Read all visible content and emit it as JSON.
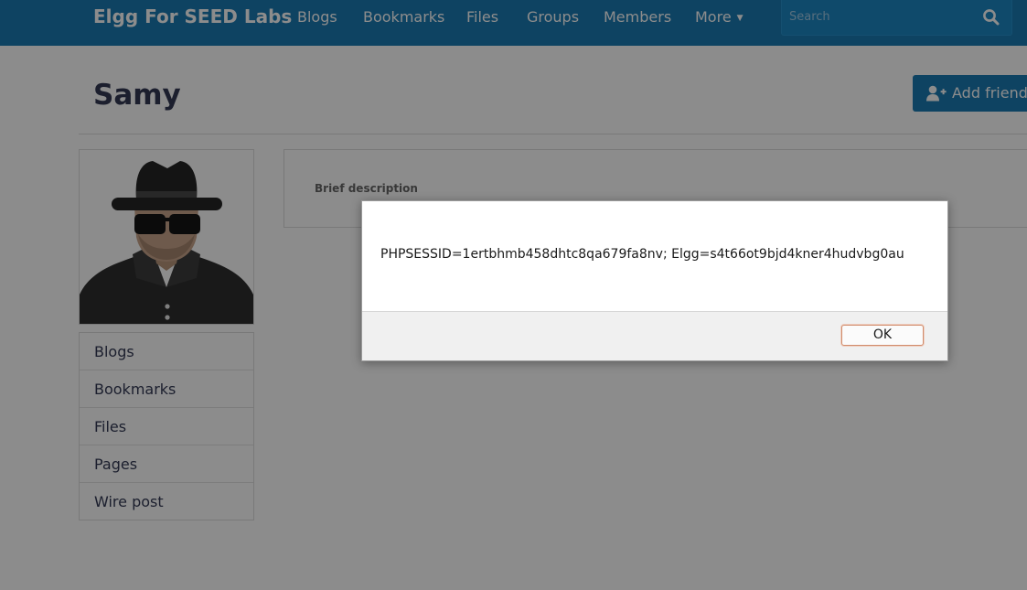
{
  "topbar": {
    "brand": "Elgg For SEED Labs",
    "nav": [
      {
        "label": "Blogs"
      },
      {
        "label": "Bookmarks"
      },
      {
        "label": "Files"
      },
      {
        "label": "Groups"
      },
      {
        "label": "Members"
      },
      {
        "label": "More"
      }
    ],
    "search": {
      "placeholder": "Search",
      "value": ""
    }
  },
  "profile": {
    "title": "Samy",
    "add_friend_label": "Add friend",
    "brief_description_label": "Brief description",
    "owner_menu": [
      {
        "label": "Blogs"
      },
      {
        "label": "Bookmarks"
      },
      {
        "label": "Files"
      },
      {
        "label": "Pages"
      },
      {
        "label": "Wire post"
      }
    ]
  },
  "alert": {
    "message": "PHPSESSID=1ertbhmb458dhtc8qa679fa8nv; Elgg=s4t66ot9bjd4kner4hudvbg0au",
    "ok_label": "OK"
  },
  "colors": {
    "topbar": "#1a7ab2",
    "title_text": "#333a55",
    "overlay": "rgba(0,0,0,0.45)",
    "ok_focus_border": "#d08c6c"
  },
  "icons": {
    "search": "search-icon",
    "add_friend": "user-plus-icon",
    "more": "chevron-down-icon"
  }
}
